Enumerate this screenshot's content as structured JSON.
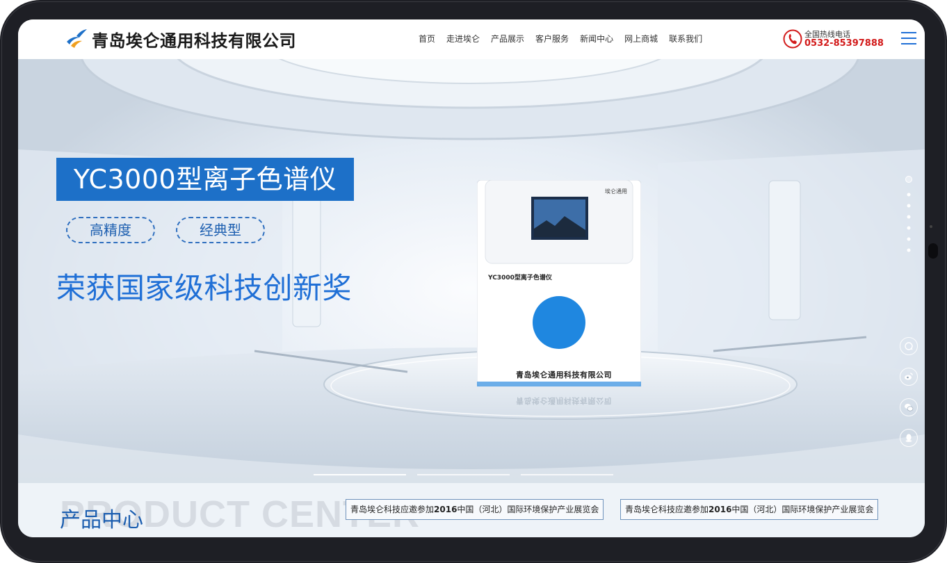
{
  "brand": {
    "name": "青岛埃仑通用科技有限公司",
    "logo": "bird-logo-icon"
  },
  "nav": {
    "items": [
      "首页",
      "走进埃仑",
      "产品展示",
      "客户服务",
      "新闻中心",
      "网上商城",
      "联系我们"
    ]
  },
  "hotline": {
    "label": "全国热线电话",
    "number": "0532-85397888"
  },
  "hero": {
    "title": "YC3000型离子色谱仪",
    "tags": [
      "高精度",
      "经典型"
    ],
    "award": "荣获国家级科技创新奖",
    "device": {
      "brand": "埃仑通用",
      "model": "YC3000型离子色谱仪",
      "company": "青岛埃仑通用科技有限公司"
    },
    "slides": 3,
    "active_slide": 0
  },
  "side_icons": [
    "chat-icon",
    "weibo-icon",
    "wechat-icon",
    "qq-icon"
  ],
  "product_section": {
    "title": "产品中心",
    "bg_word": "PRODUCT CENTER"
  },
  "news": [
    {
      "prefix": "青岛埃仑科技应邀参加",
      "year": "2016",
      "suffix": "中国（河北）国际环境保护产业展览会"
    },
    {
      "prefix": "青岛埃仑科技应邀参加",
      "year": "2016",
      "suffix": "中国（河北）国际环境保护产业展览会"
    }
  ],
  "colors": {
    "accent": "#1d70c8",
    "hotline": "#d21a1a",
    "frame": "#1e1f25"
  }
}
